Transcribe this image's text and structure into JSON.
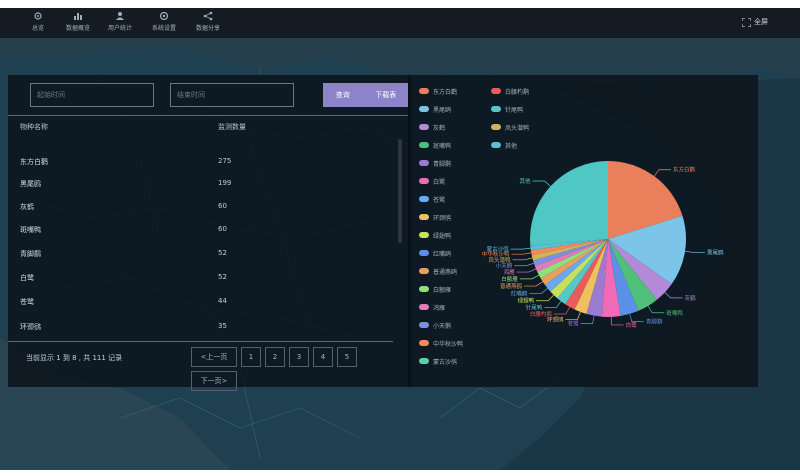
{
  "nav": [
    {
      "label": "总览",
      "icon": "gear-icon"
    },
    {
      "label": "数据概览",
      "icon": "chart-icon"
    },
    {
      "label": "用户统计",
      "icon": "user-icon"
    },
    {
      "label": "系统设置",
      "icon": "settings-icon"
    },
    {
      "label": "数据分享",
      "icon": "share-icon"
    }
  ],
  "fullscreen_label": "全屏",
  "filters": {
    "start_placeholder": "起始时间",
    "end_placeholder": "结束时间",
    "query_label": "查询",
    "download_label": "下载表"
  },
  "table": {
    "col_name": "物种名称",
    "col_count": "监测数量",
    "rows": [
      {
        "name": "东方白鹳",
        "count": "275"
      },
      {
        "name": "黑尾鸥",
        "count": "199"
      },
      {
        "name": "灰鹤",
        "count": "60"
      },
      {
        "name": "斑嘴鸭",
        "count": "60"
      },
      {
        "name": "青脚鹬",
        "count": "52"
      },
      {
        "name": "白鹭",
        "count": "52"
      },
      {
        "name": "苍鹭",
        "count": "44"
      },
      {
        "name": "环颈鸻",
        "count": "35"
      }
    ]
  },
  "pagination": {
    "info": "当前显示 1 到 8 , 共 111 记录",
    "prev": "<上一页",
    "pages": [
      "1",
      "2",
      "3",
      "4",
      "5"
    ],
    "next": "下一页>"
  },
  "legend": [
    {
      "name": "东方白鹳",
      "color": "#ea7f5c"
    },
    {
      "name": "黑尾鸥",
      "color": "#7cc4e8"
    },
    {
      "name": "灰鹤",
      "color": "#b38ad8"
    },
    {
      "name": "斑嘴鸭",
      "color": "#4fc07a"
    },
    {
      "name": "青脚鹬",
      "color": "#9a7bd0"
    },
    {
      "name": "白鹭",
      "color": "#f06ab5"
    },
    {
      "name": "苍鹭",
      "color": "#6aa9f0"
    },
    {
      "name": "环颈鸻",
      "color": "#f0c060"
    },
    {
      "name": "白腰杓鹬",
      "color": "#e85c5c"
    },
    {
      "name": "针尾鸭",
      "color": "#55c7c7"
    },
    {
      "name": "绿翅鸭",
      "color": "#c7e15f"
    },
    {
      "name": "红嘴鸥",
      "color": "#5c8fe8"
    },
    {
      "name": "普通燕鸥",
      "color": "#e8a05c"
    },
    {
      "name": "白额雁",
      "color": "#8fe07c"
    },
    {
      "name": "鸿雁",
      "color": "#e07cb8"
    },
    {
      "name": "小天鹅",
      "color": "#7c8fe0"
    },
    {
      "name": "凤头潜鸭",
      "color": "#d0b35a"
    },
    {
      "name": "其他",
      "color": "#5ad0a8"
    },
    {
      "name": "中华秋沙鸭",
      "color": "#f08a5c"
    },
    {
      "name": "蒙古沙鸻",
      "color": "#5cc0d0"
    }
  ],
  "chart_data": {
    "type": "pie",
    "series": [
      {
        "name": "东方白鹳",
        "value": 275,
        "color": "#ea7f5c"
      },
      {
        "name": "黑尾鸥",
        "value": 199,
        "color": "#7cc4e8"
      },
      {
        "name": "灰鹤",
        "value": 60,
        "color": "#b38ad8"
      },
      {
        "name": "斑嘴鸭",
        "value": 60,
        "color": "#4fc07a"
      },
      {
        "name": "青脚鹬",
        "value": 52,
        "color": "#5c8fe8"
      },
      {
        "name": "白鹭",
        "value": 52,
        "color": "#f06ab5"
      },
      {
        "name": "苍鹭",
        "value": 44,
        "color": "#9a7bd0"
      },
      {
        "name": "环颈鸻",
        "value": 35,
        "color": "#f0c060"
      },
      {
        "name": "白腰杓鹬",
        "value": 30,
        "color": "#e85c5c"
      },
      {
        "name": "针尾鸭",
        "value": 28,
        "color": "#55c7c7"
      },
      {
        "name": "绿翅鸭",
        "value": 26,
        "color": "#c7e15f"
      },
      {
        "name": "红嘴鸥",
        "value": 24,
        "color": "#6aa9f0"
      },
      {
        "name": "普通燕鸥",
        "value": 22,
        "color": "#e8a05c"
      },
      {
        "name": "白额雁",
        "value": 20,
        "color": "#8fe07c"
      },
      {
        "name": "鸿雁",
        "value": 18,
        "color": "#e07cb8"
      },
      {
        "name": "小天鹅",
        "value": 16,
        "color": "#7c8fe0"
      },
      {
        "name": "凤头潜鸭",
        "value": 15,
        "color": "#d0b35a"
      },
      {
        "name": "中华秋沙鸭",
        "value": 14,
        "color": "#f08a5c"
      },
      {
        "name": "蒙古沙鸻",
        "value": 12,
        "color": "#5cc0d0"
      },
      {
        "name": "其他",
        "value": 360,
        "color": "#4fc7c4"
      }
    ]
  }
}
